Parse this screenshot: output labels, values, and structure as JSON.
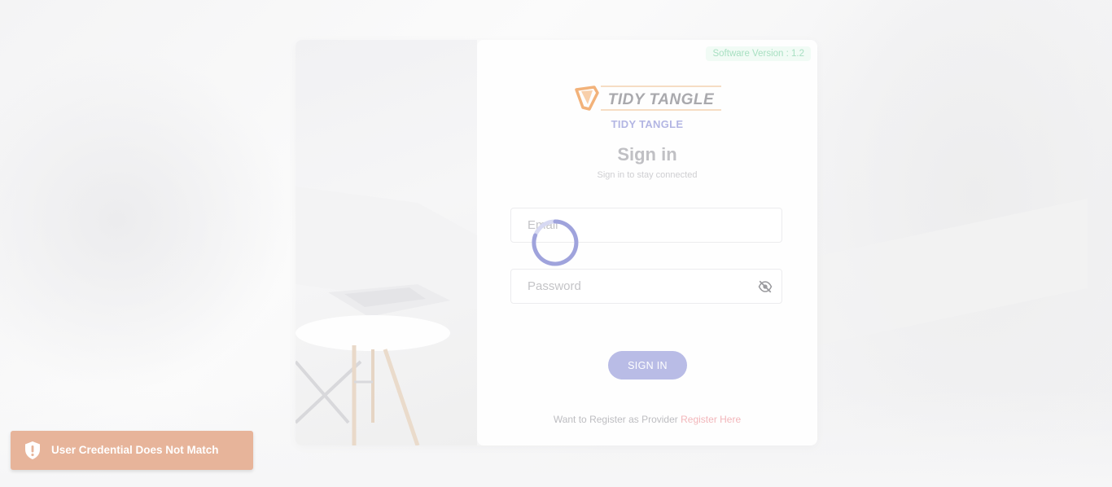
{
  "app": {
    "version_text": "Software Version : 1.2",
    "brand_logo_text": "TIDY TANGLE",
    "brand_name": "TIDY TANGLE",
    "title": "Sign in",
    "subtitle": "Sign in to stay connected"
  },
  "form": {
    "email_placeholder": "Email",
    "email_value": "",
    "password_placeholder": "Password",
    "password_value": "",
    "password_toggle_icon": "eye-off-icon",
    "submit_label": "SIGN IN"
  },
  "register": {
    "prompt": "Want to Register as Provider",
    "link_label": "Register Here"
  },
  "toast": {
    "icon": "shield-alert-icon",
    "message": "User Credential Does Not Match"
  },
  "loading": {
    "icon": "spinner-icon"
  },
  "colors": {
    "accent": "#b9bce6",
    "brand_text": "#b3b6e3",
    "version_badge": "#a8e0c2",
    "register_link": "#f2b6ba",
    "toast_bg": "#e7b49a",
    "logo_orange": "#f2b27a"
  }
}
